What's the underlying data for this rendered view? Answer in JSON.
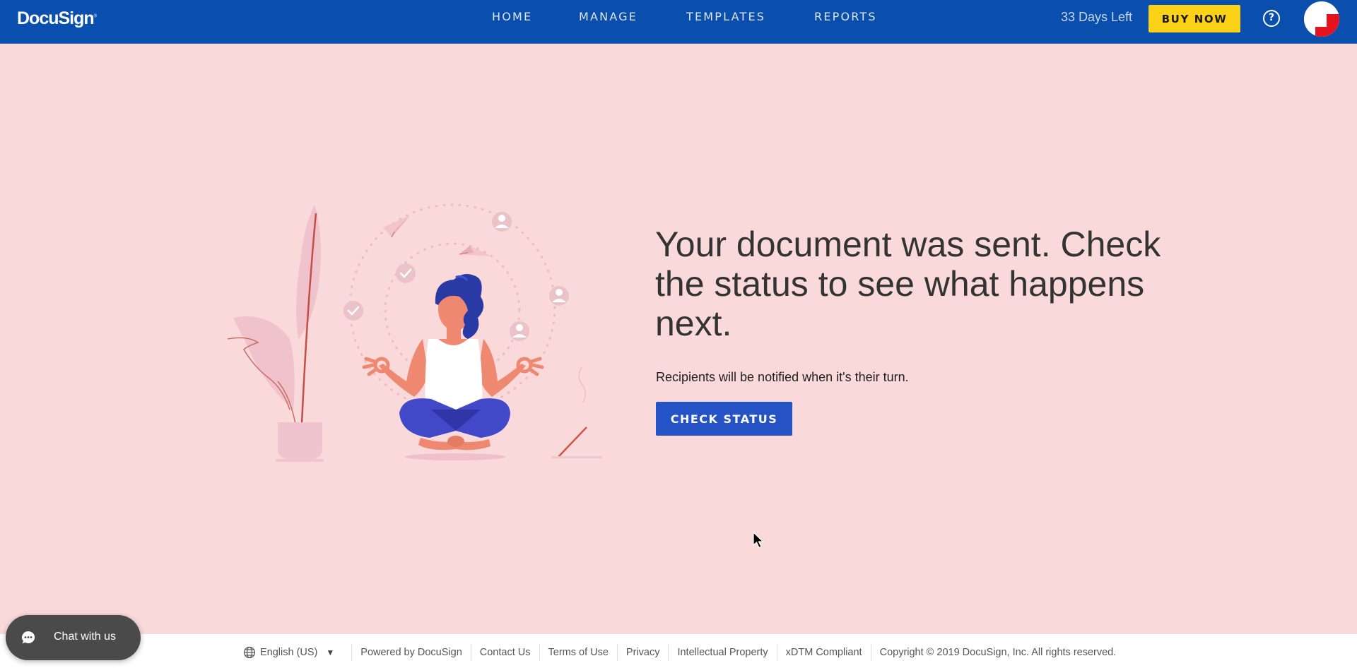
{
  "header": {
    "logo": "DocuSign",
    "logo_mark": "®",
    "nav": [
      {
        "label": "HOME"
      },
      {
        "label": "MANAGE"
      },
      {
        "label": "TEMPLATES"
      },
      {
        "label": "REPORTS"
      }
    ],
    "trial_status": "33 Days Left",
    "buy_now_label": "BUY NOW",
    "help_icon": "?",
    "accent_color": "#0a4fad",
    "buy_now_color": "#fcd116"
  },
  "main": {
    "headline": "Your document was sent. Check the status to see what happens next.",
    "subtext": "Recipients will be notified when it's their turn.",
    "check_status_label": "CHECK STATUS",
    "button_color": "#2553c6",
    "background_color": "#f9d9d9"
  },
  "chat": {
    "label": "Chat with us"
  },
  "footer": {
    "language": "English (US)",
    "links": [
      {
        "label": "Powered by DocuSign"
      },
      {
        "label": "Contact Us"
      },
      {
        "label": "Terms of Use"
      },
      {
        "label": "Privacy"
      },
      {
        "label": "Intellectual Property"
      },
      {
        "label": "xDTM Compliant"
      }
    ],
    "copyright": "Copyright © 2019 DocuSign, Inc. All rights reserved."
  }
}
